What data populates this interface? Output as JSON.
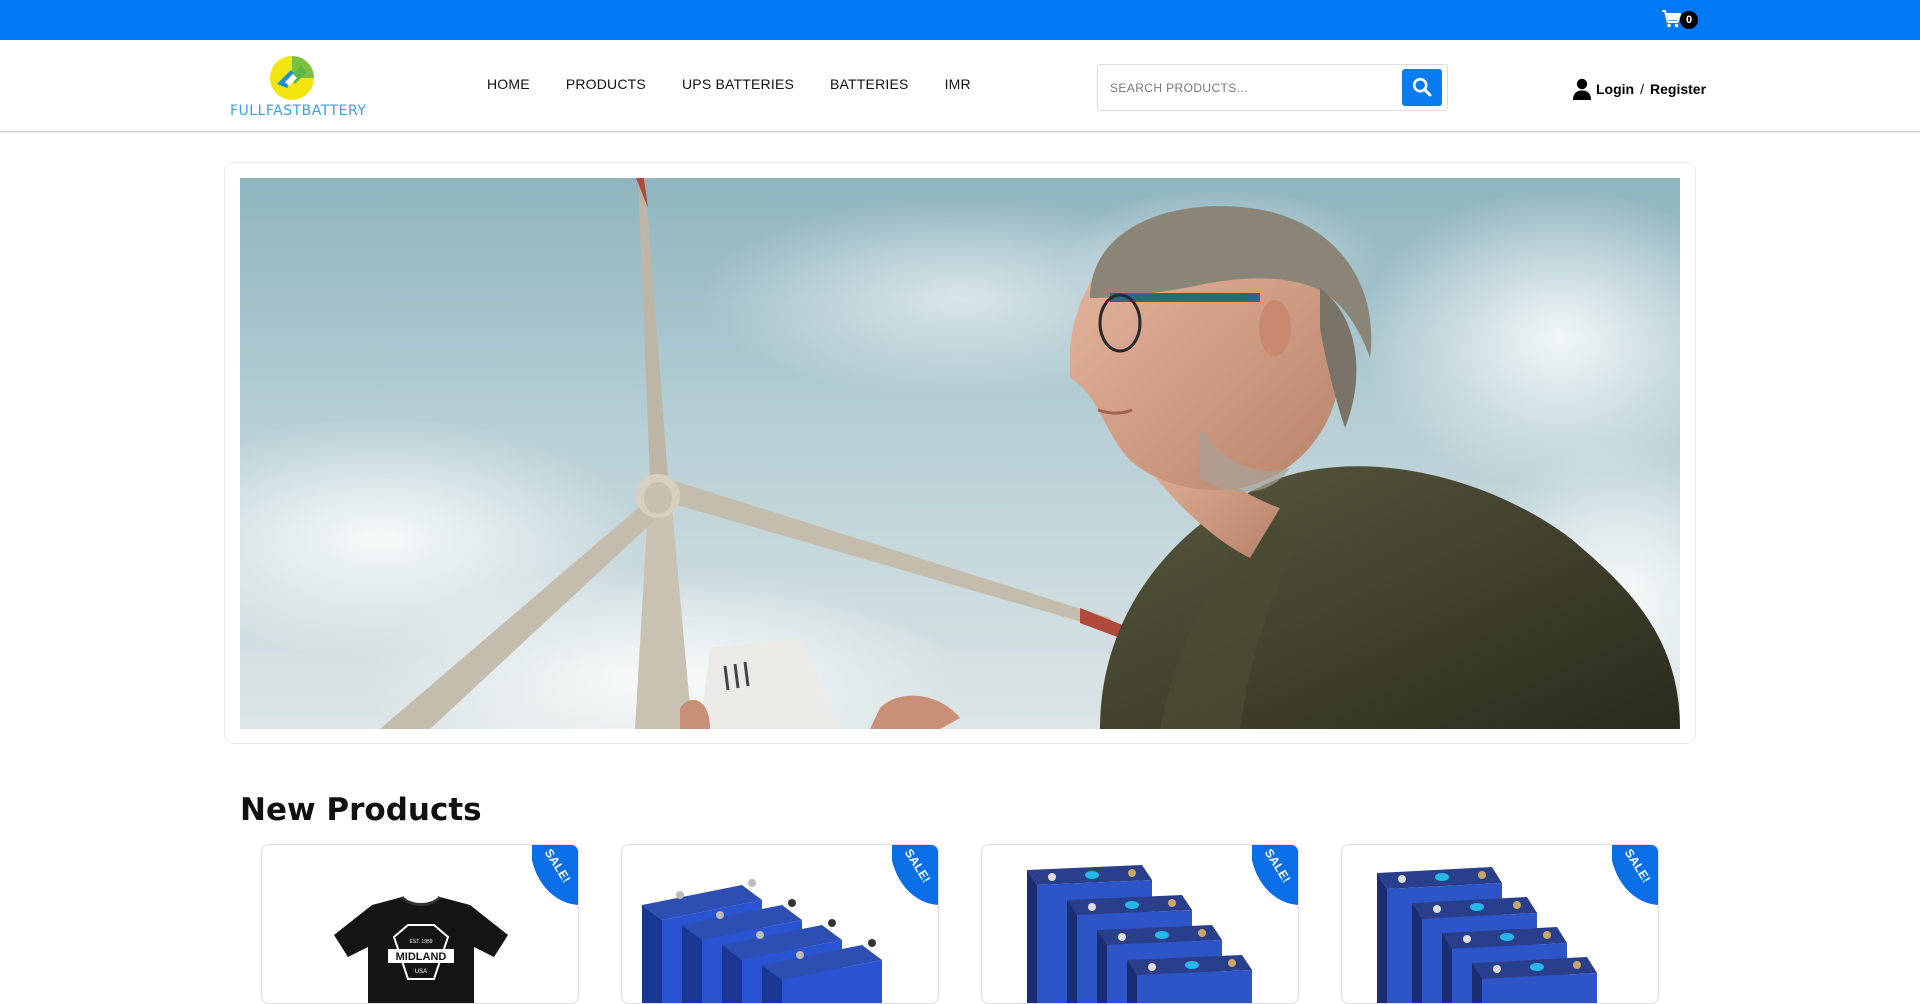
{
  "topbar": {
    "cart_count": "0",
    "icon": "cart-icon",
    "color": "#0079f6"
  },
  "header": {
    "logo_text": "FULLFASTBATTERY",
    "nav": [
      "HOME",
      "PRODUCTS",
      "UPS BATTERIES",
      "BATTERIES",
      "IMR"
    ],
    "search_placeholder": "SEARCH PRODUCTS...",
    "login_label": "Login",
    "separator": "/",
    "register_label": "Register"
  },
  "hero": {
    "image": "man-with-wind-turbine-photo"
  },
  "new_products": {
    "title": "New Products",
    "items": [
      {
        "badge": "SALE!",
        "image": "midland-t-shirt"
      },
      {
        "badge": "SALE!",
        "image": "lifepo4-cell-pack"
      },
      {
        "badge": "SALE!",
        "image": "lifepo4-cell-pack"
      },
      {
        "badge": "SALE!",
        "image": "lifepo4-cell-pack"
      }
    ]
  },
  "colors": {
    "accent": "#0a7bf0",
    "sale_badge": "#0a6fe6"
  }
}
